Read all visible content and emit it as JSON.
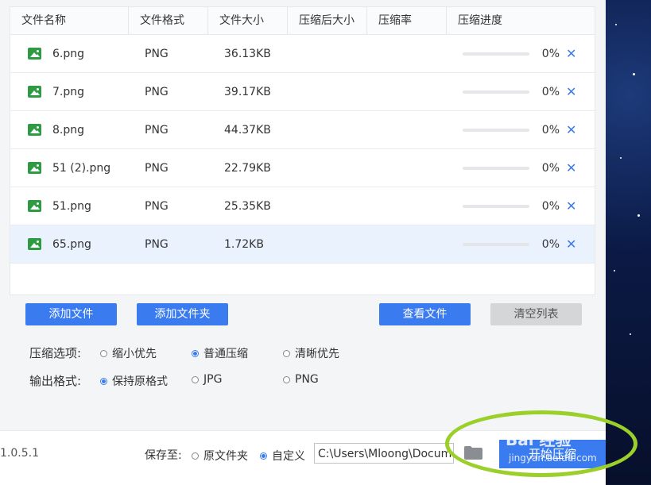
{
  "table": {
    "headers": [
      "文件名称",
      "文件格式",
      "文件大小",
      "压缩后大小",
      "压缩率",
      "压缩进度"
    ],
    "rows": [
      {
        "name": "6.png",
        "format": "PNG",
        "size": "36.13KB",
        "compressed_size": "",
        "rate": "",
        "progress": "0%",
        "progress_value": 0
      },
      {
        "name": "7.png",
        "format": "PNG",
        "size": "39.17KB",
        "compressed_size": "",
        "rate": "",
        "progress": "0%",
        "progress_value": 0
      },
      {
        "name": "8.png",
        "format": "PNG",
        "size": "44.37KB",
        "compressed_size": "",
        "rate": "",
        "progress": "0%",
        "progress_value": 0
      },
      {
        "name": "51 (2).png",
        "format": "PNG",
        "size": "22.79KB",
        "compressed_size": "",
        "rate": "",
        "progress": "0%",
        "progress_value": 0
      },
      {
        "name": "51.png",
        "format": "PNG",
        "size": "25.35KB",
        "compressed_size": "",
        "rate": "",
        "progress": "0%",
        "progress_value": 0
      },
      {
        "name": "65.png",
        "format": "PNG",
        "size": "1.72KB",
        "compressed_size": "",
        "rate": "",
        "progress": "0%",
        "progress_value": 0
      }
    ],
    "row_icon": "image-file-icon",
    "delete_icon": "close-icon",
    "delete_glyph": "✕"
  },
  "buttons": {
    "add_file": "添加文件",
    "add_folder": "添加文件夹",
    "view_files": "查看文件",
    "clear_list": "清空列表"
  },
  "compress_options": {
    "label": "压缩选项:",
    "options": [
      "缩小优先",
      "普通压缩",
      "清晰优先"
    ],
    "selected": "普通压缩"
  },
  "output_format": {
    "label": "输出格式:",
    "options": [
      "保持原格式",
      "JPG",
      "PNG"
    ],
    "selected": "保持原格式"
  },
  "footer": {
    "version": "1.0.5.1",
    "save_to_label": "保存至:",
    "save_options": [
      "原文件夹",
      "自定义"
    ],
    "save_selected": "自定义",
    "path": "C:\\Users\\Mloong\\Documents",
    "folder_icon": "folder-icon",
    "start_button": "开始压缩"
  },
  "watermark": {
    "text": "Bai 经验",
    "url": "jingyan.baidu.com"
  },
  "colors": {
    "accent": "#3a7bf0",
    "selected_row": "#eaf3fd",
    "highlight_ellipse": "#9bcf2a",
    "image_icon": "#2e9b42"
  }
}
